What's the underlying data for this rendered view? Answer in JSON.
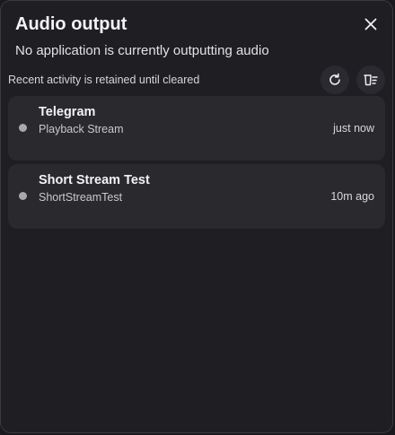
{
  "header": {
    "title": "Audio output",
    "close_icon": "close-icon"
  },
  "status": {
    "message": "No application is currently outputting audio"
  },
  "activity": {
    "note": "Recent activity is retained until cleared",
    "refresh_icon": "refresh-icon",
    "clear_icon": "clear-history-icon"
  },
  "items": [
    {
      "name": "Telegram",
      "stream": "Playback Stream",
      "time": "just now"
    },
    {
      "name": "Short Stream Test",
      "stream": "ShortStreamTest",
      "time": "10m ago"
    }
  ],
  "colors": {
    "background": "#1f1e23",
    "card": "#2a292e",
    "indicator": "#a9a8ad",
    "text": "#f3f2f6"
  }
}
